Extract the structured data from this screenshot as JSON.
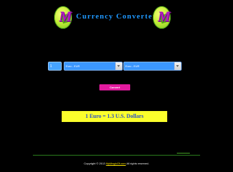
{
  "header": {
    "logo_letter": "M",
    "title": "Currency Converter"
  },
  "form": {
    "amount_value": "1",
    "from_currency": "Euro - EUR",
    "to_currency": "Euro - EUR",
    "convert_label": "Convert"
  },
  "result": {
    "text": "1 Euro = 1.3 U.S. Dollars"
  },
  "footer": {
    "prefix": "Copyright © 2013 ",
    "link_text": "MyMagicOf.com",
    "suffix": " All rights reserved."
  },
  "colors": {
    "background": "#000000",
    "title_blue": "#1f98ff",
    "input_blue": "#45a3ff",
    "button_pink": "#e21a9e",
    "result_yellow": "#fbff2c",
    "link_yellow": "#ffe600",
    "rule_green": "#2b7f1d"
  },
  "icons": {
    "logo": "magic-logo-icon",
    "dropdown": "chevron-down-icon"
  }
}
